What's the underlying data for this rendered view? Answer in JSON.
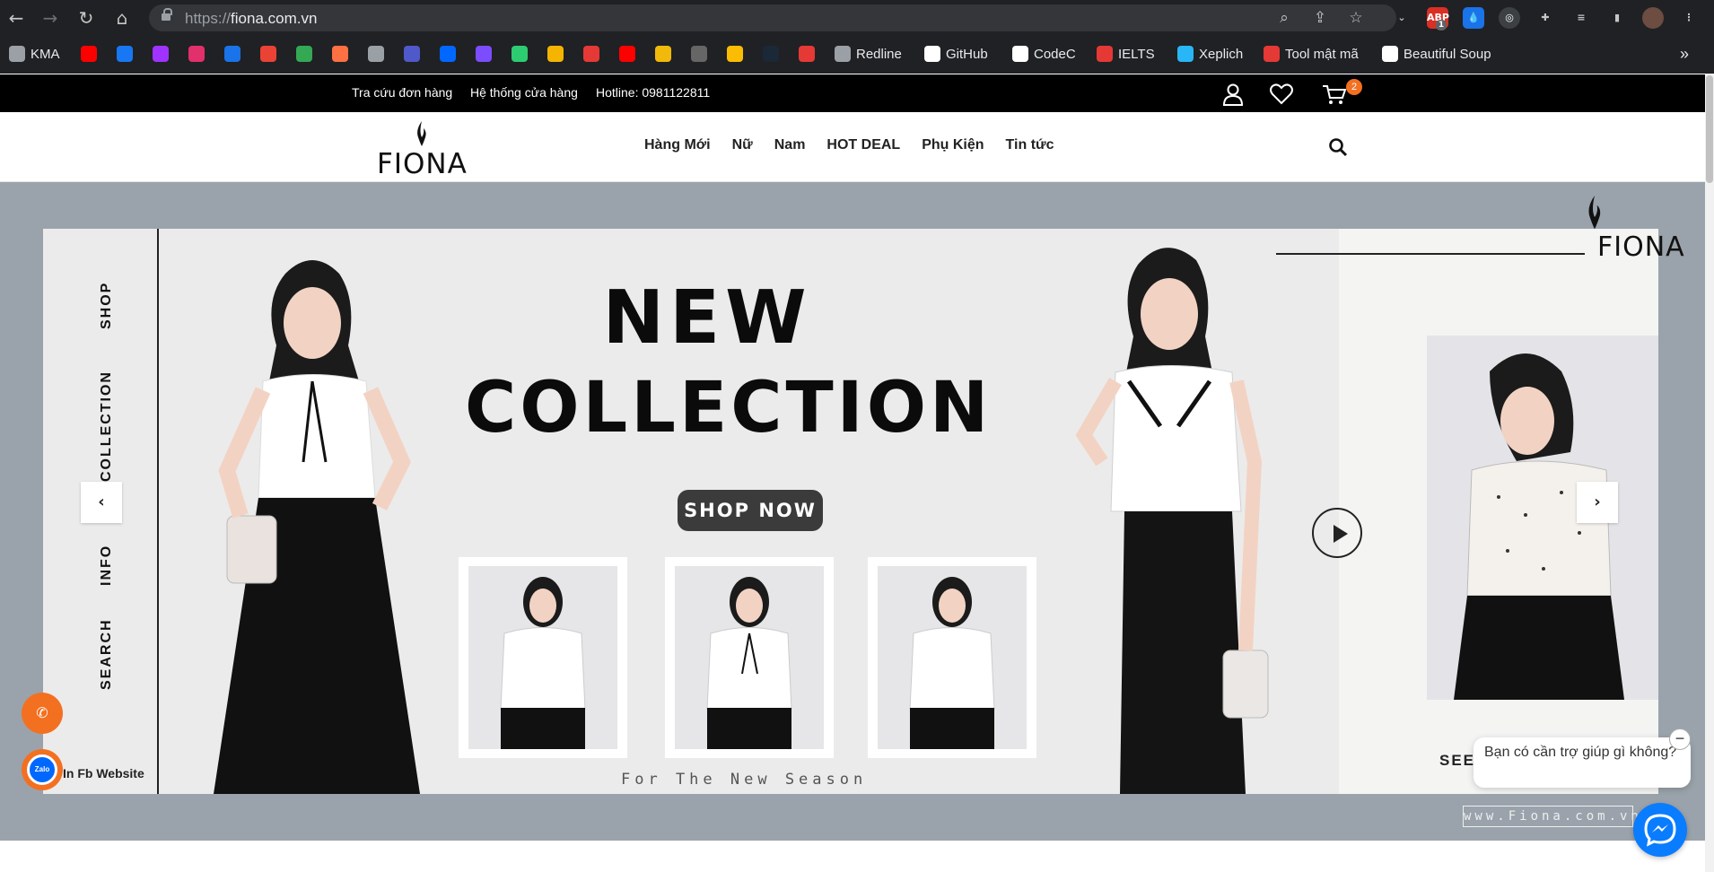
{
  "browser": {
    "url_protocol": "https://",
    "url_host": "fiona.com.vn",
    "icons": {
      "back": "arrow-left-icon",
      "forward": "arrow-right-icon",
      "reload": "reload-icon",
      "home": "home-icon",
      "zoom": "zoom-icon",
      "share": "share-icon",
      "star": "star-icon",
      "extensions": "puzzle-icon",
      "menu": "kebab-menu-icon"
    },
    "ext_badge": "1",
    "bookmarks": [
      {
        "label": "KMA",
        "color": "#9aa0a6"
      },
      {
        "label": "",
        "color": "#ff0000"
      },
      {
        "label": "",
        "color": "#1877f2"
      },
      {
        "label": "",
        "color": "#a033ff"
      },
      {
        "label": "",
        "color": "#e1306c"
      },
      {
        "label": "",
        "color": "#1a73e8"
      },
      {
        "label": "",
        "color": "#ea4335"
      },
      {
        "label": "",
        "color": "#34a853"
      },
      {
        "label": "",
        "color": "#ff7043"
      },
      {
        "label": "",
        "color": "#9aa0a6"
      },
      {
        "label": "",
        "color": "#5059c9"
      },
      {
        "label": "",
        "color": "#0068ff"
      },
      {
        "label": "",
        "color": "#7c4dff"
      },
      {
        "label": "",
        "color": "#2ecc71"
      },
      {
        "label": "",
        "color": "#f4b400"
      },
      {
        "label": "",
        "color": "#e53935"
      },
      {
        "label": "",
        "color": "#ff0000"
      },
      {
        "label": "",
        "color": "#f0b90b"
      },
      {
        "label": "",
        "color": "#666666"
      },
      {
        "label": "",
        "color": "#fbbc04"
      },
      {
        "label": "",
        "color": "#1b2838"
      },
      {
        "label": "",
        "color": "#e53935"
      },
      {
        "label": "Redline",
        "color": "#9aa0a6"
      },
      {
        "label": "GitHub",
        "color": "#ffffff"
      },
      {
        "label": "CodeC",
        "color": "#ffffff"
      },
      {
        "label": "IELTS",
        "color": "#e53935"
      },
      {
        "label": "Xeplich",
        "color": "#29b6f6"
      },
      {
        "label": "Tool mật mã",
        "color": "#e53935"
      },
      {
        "label": "Beautiful Soup",
        "color": "#ffffff"
      }
    ],
    "overflow_label": "»"
  },
  "topbar": {
    "links": [
      "Tra cứu đơn hàng",
      "Hệ thống cửa hàng",
      "Hotline: 0981122811"
    ],
    "cart_count": "2",
    "icons": [
      "user-icon",
      "heart-icon",
      "cart-icon"
    ]
  },
  "header": {
    "logo_text": "FIONA",
    "menu": [
      "Hàng Mới",
      "Nữ",
      "Nam",
      "HOT DEAL",
      "Phụ Kiện",
      "Tin tức"
    ]
  },
  "hero": {
    "side_labels": [
      "SHOP",
      "COLLECTION",
      "INFO",
      "SEARCH"
    ],
    "headline_1": "NEW",
    "headline_2": "COLLECTION",
    "cta": "SHOP NOW",
    "tagline": "For The New Season",
    "brand_corner": "FIONA",
    "see_label": "SEE",
    "watermark": "www.Fiona.com.vn",
    "prev_arrow": "‹",
    "next_arrow": "›"
  },
  "widgets": {
    "zalo_label": "Zalo",
    "fb_label": "In Fb Website",
    "chat_prompt": "Bạn có cần trợ giúp gì không?",
    "close_label": "−",
    "colors": {
      "accent": "#f37021",
      "messenger": "#0a7cff"
    }
  }
}
